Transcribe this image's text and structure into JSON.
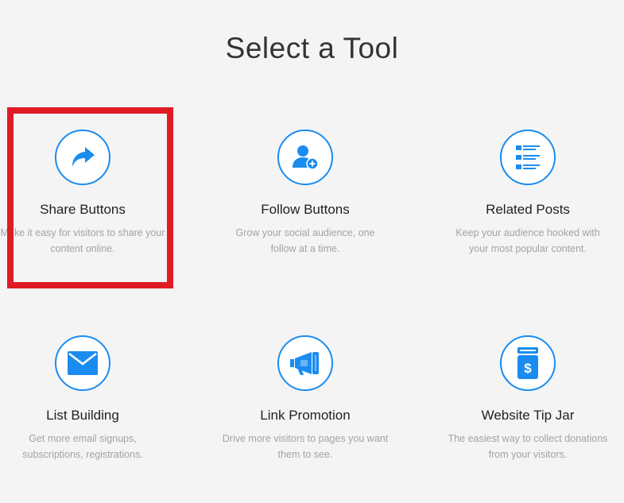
{
  "page": {
    "title": "Select a Tool"
  },
  "colors": {
    "accent": "#1a8cf0",
    "highlight": "#e01b24"
  },
  "tools": [
    {
      "name": "Share Buttons",
      "description": "Make it easy for visitors to share your\ncontent online.",
      "icon": "share-arrow-icon",
      "highlighted": true
    },
    {
      "name": "Follow Buttons",
      "description": "Grow your social audience, one\nfollow at a time.",
      "icon": "add-user-icon",
      "highlighted": false
    },
    {
      "name": "Related Posts",
      "description": "Keep your audience hooked with\nyour most popular content.",
      "icon": "list-icon",
      "highlighted": false
    },
    {
      "name": "List Building",
      "description": "Get more email signups,\nsubscriptions, registrations.",
      "icon": "envelope-icon",
      "highlighted": false
    },
    {
      "name": "Link Promotion",
      "description": "Drive more visitors to pages you want\nthem to see.",
      "icon": "megaphone-icon",
      "highlighted": false
    },
    {
      "name": "Website Tip Jar",
      "description": "The easiest way to collect donations\nfrom your visitors.",
      "icon": "tip-jar-icon",
      "highlighted": false
    }
  ]
}
